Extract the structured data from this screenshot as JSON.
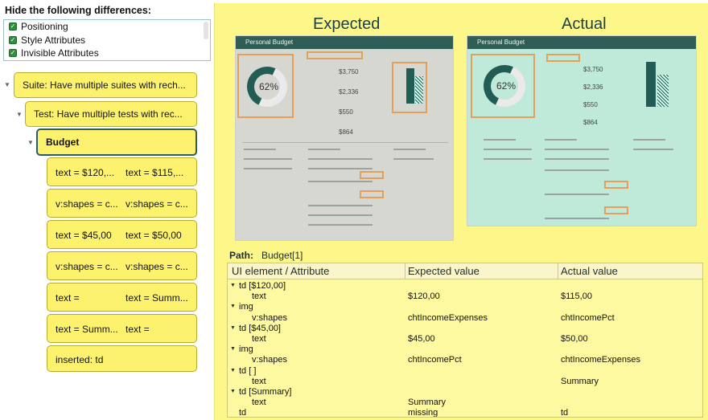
{
  "filters": {
    "title": "Hide the following differences:",
    "options": [
      {
        "label": "Positioning",
        "checked": true
      },
      {
        "label": "Style Attributes",
        "checked": true
      },
      {
        "label": "Invisible Attributes",
        "checked": true
      }
    ]
  },
  "tree": {
    "suite": "Suite: Have multiple suites with rech...",
    "test": "Test: Have multiple tests with rec...",
    "selected": "Budget",
    "leaves": [
      {
        "a": "text = $120,...",
        "b": "text = $115,..."
      },
      {
        "a": "v:shapes = c...",
        "b": "v:shapes = c..."
      },
      {
        "a": "text = $45,00",
        "b": "text = $50,00"
      },
      {
        "a": "v:shapes = c...",
        "b": "v:shapes = c..."
      },
      {
        "a": "text =",
        "b": "text = Summ..."
      },
      {
        "a": "text = Summ...",
        "b": "text ="
      },
      {
        "a": "inserted: td",
        "b": ""
      }
    ]
  },
  "compare": {
    "expected_title": "Expected",
    "actual_title": "Actual",
    "expected_shot": {
      "bar": "Personal Budget",
      "pct": "62%",
      "amounts": [
        "$3,750",
        "$2,336",
        "$550",
        "$864"
      ]
    },
    "actual_shot": {
      "bar": "Personal Budget",
      "pct": "62%",
      "amounts": [
        "$3,750",
        "$2,336",
        "$550",
        "$864"
      ]
    }
  },
  "path": {
    "label": "Path:",
    "value": "Budget[1]"
  },
  "diff_table": {
    "columns": [
      "UI element / Attribute",
      "Expected value",
      "Actual value"
    ],
    "rows": [
      {
        "indent": 0,
        "expander": true,
        "name": "td [$120,00]",
        "expected": "",
        "actual": ""
      },
      {
        "indent": 1,
        "expander": false,
        "name": "text",
        "expected": "$120,00",
        "actual": "$115,00"
      },
      {
        "indent": 0,
        "expander": true,
        "name": "img",
        "expected": "",
        "actual": ""
      },
      {
        "indent": 1,
        "expander": false,
        "name": "v:shapes",
        "expected": "chtIncomeExpenses",
        "actual": "chtIncomePct"
      },
      {
        "indent": 0,
        "expander": true,
        "name": "td [$45,00]",
        "expected": "",
        "actual": ""
      },
      {
        "indent": 1,
        "expander": false,
        "name": "text",
        "expected": "$45,00",
        "actual": "$50,00"
      },
      {
        "indent": 0,
        "expander": true,
        "name": "img",
        "expected": "",
        "actual": ""
      },
      {
        "indent": 1,
        "expander": false,
        "name": "v:shapes",
        "expected": "chtIncomePct",
        "actual": "chtIncomeExpenses"
      },
      {
        "indent": 0,
        "expander": true,
        "name": "td [ ]",
        "expected": "",
        "actual": ""
      },
      {
        "indent": 1,
        "expander": false,
        "name": "text",
        "expected": "",
        "actual": "Summary"
      },
      {
        "indent": 0,
        "expander": true,
        "name": "td [Summary]",
        "expected": "",
        "actual": ""
      },
      {
        "indent": 1,
        "expander": false,
        "name": "text",
        "expected": "Summary",
        "actual": ""
      },
      {
        "indent": 0,
        "expander": false,
        "name": "td",
        "expected": "missing",
        "actual": "td"
      }
    ]
  },
  "colors": {
    "highlight": "#fdf26e",
    "panel": "#fdf78a",
    "accent": "#215d55",
    "marker": "#e3a05a"
  }
}
